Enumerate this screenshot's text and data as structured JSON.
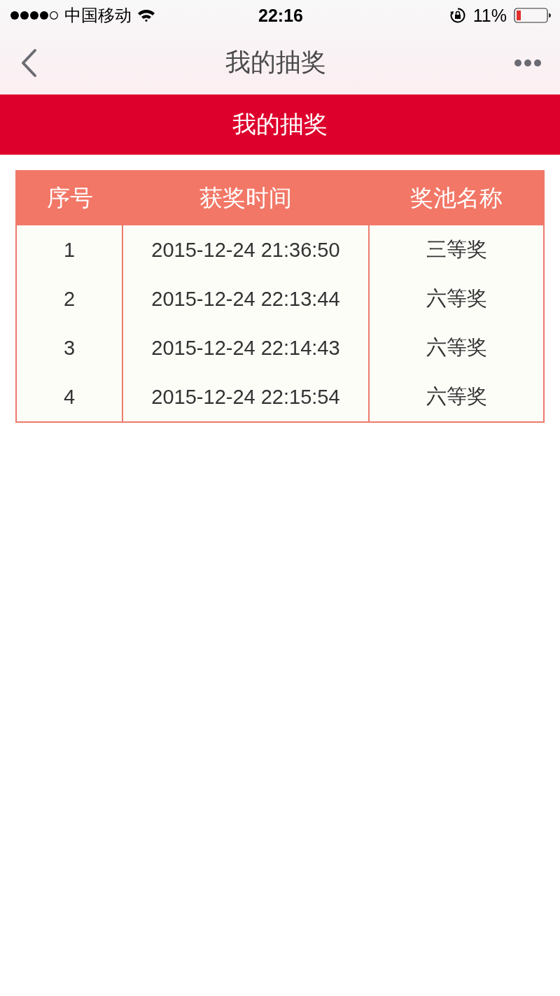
{
  "status_bar": {
    "carrier": "中国移动",
    "time": "22:16",
    "battery": "11%"
  },
  "nav_bar": {
    "title": "我的抽奖"
  },
  "banner": {
    "title": "我的抽奖"
  },
  "table": {
    "columns": [
      "序号",
      "获奖时间",
      "奖池名称"
    ],
    "rows": [
      [
        "1",
        "2015-12-24 21:36:50",
        "三等奖"
      ],
      [
        "2",
        "2015-12-24 22:13:44",
        "六等奖"
      ],
      [
        "3",
        "2015-12-24 22:14:43",
        "六等奖"
      ],
      [
        "4",
        "2015-12-24 22:15:54",
        "六等奖"
      ]
    ]
  }
}
